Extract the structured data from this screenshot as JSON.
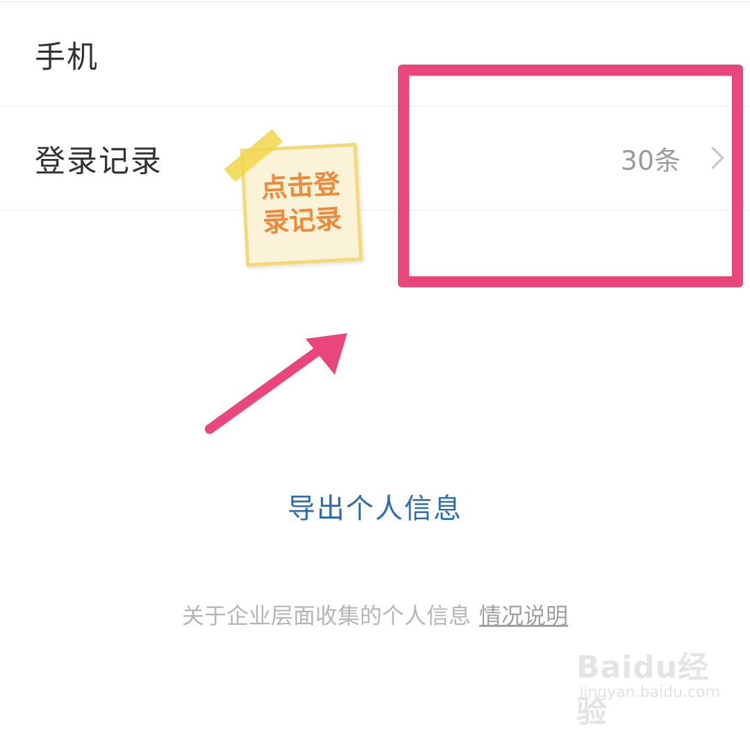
{
  "settings": {
    "rows": [
      {
        "label": "手机",
        "value": ""
      },
      {
        "label": "登录记录",
        "value": "30条"
      }
    ]
  },
  "export_link": "导出个人信息",
  "footer": {
    "text": "关于企业层面收集的个人信息",
    "link": "情况说明"
  },
  "annotation": {
    "note_text": "点击登录记录",
    "highlight_color": "#e9467c",
    "arrow_color": "#e9467c",
    "note_text_color": "#ee8a3c"
  },
  "watermark": {
    "logo": "Baidu经验",
    "url": "jingyan.baidu.com"
  },
  "colors": {
    "link_blue": "#2b6cb0",
    "label": "#333333",
    "muted": "#9b9b9b"
  }
}
